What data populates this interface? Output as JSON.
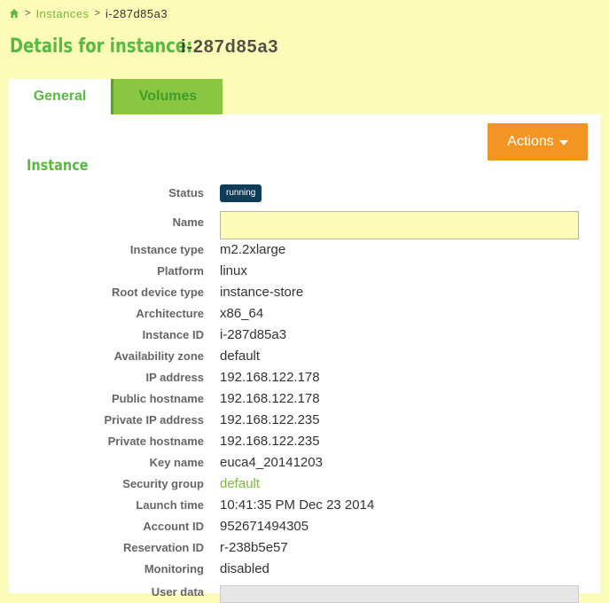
{
  "breadcrumb": {
    "items": [
      "Instances"
    ],
    "current": "i-287d85a3"
  },
  "page": {
    "title_prefix": "Details for instance:",
    "title_id": "i-287d85a3"
  },
  "tabs": [
    {
      "label": "General",
      "active": true
    },
    {
      "label": "Volumes",
      "active": false
    }
  ],
  "actions": {
    "label": "Actions"
  },
  "section": {
    "title": "Instance"
  },
  "fields": {
    "status": {
      "label": "Status",
      "value": "running"
    },
    "name": {
      "label": "Name",
      "value": "",
      "placeholder": ""
    },
    "instance_type": {
      "label": "Instance type",
      "value": "m2.2xlarge"
    },
    "platform": {
      "label": "Platform",
      "value": "linux"
    },
    "root_device_type": {
      "label": "Root device type",
      "value": "instance-store"
    },
    "architecture": {
      "label": "Architecture",
      "value": "x86_64"
    },
    "instance_id": {
      "label": "Instance ID",
      "value": "i-287d85a3"
    },
    "availability_zone": {
      "label": "Availability zone",
      "value": "default"
    },
    "ip_address": {
      "label": "IP address",
      "value": "192.168.122.178"
    },
    "public_hostname": {
      "label": "Public hostname",
      "value": "192.168.122.178"
    },
    "private_ip": {
      "label": "Private IP address",
      "value": "192.168.122.235"
    },
    "private_hostname": {
      "label": "Private hostname",
      "value": "192.168.122.235"
    },
    "key_name": {
      "label": "Key name",
      "value": "euca4_20141203"
    },
    "security_group": {
      "label": "Security group",
      "value": "default"
    },
    "launch_time": {
      "label": "Launch time",
      "value": "10:41:35 PM Dec 23 2014"
    },
    "account_id": {
      "label": "Account ID",
      "value": "952671494305"
    },
    "reservation_id": {
      "label": "Reservation ID",
      "value": "r-238b5e57"
    },
    "monitoring": {
      "label": "Monitoring",
      "value": "disabled"
    },
    "user_data": {
      "label": "User data"
    }
  },
  "colors": {
    "background": "#fcfcb8",
    "accent_green": "#5ab843",
    "link_green": "#7ab840",
    "actions_orange": "#f39522",
    "status_badge": "#0f3d58"
  },
  "icons": {
    "home": "home-icon",
    "actions_caret": "caret-down-icon",
    "separator": "chevron-right"
  }
}
